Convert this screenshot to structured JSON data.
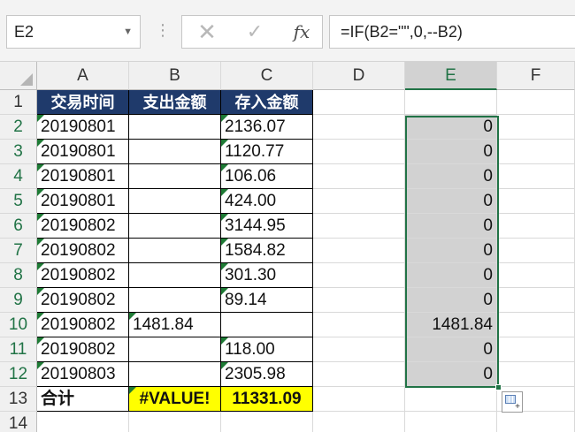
{
  "namebox": {
    "value": "E2"
  },
  "formula_bar": {
    "formula": "=IF(B2=\"\",0,--B2)",
    "cancel_icon": "close-icon",
    "enter_icon": "check-icon",
    "fx_label": "fx"
  },
  "columns": [
    "A",
    "B",
    "C",
    "D",
    "E",
    "F"
  ],
  "rows": [
    "1",
    "2",
    "3",
    "4",
    "5",
    "6",
    "7",
    "8",
    "9",
    "10",
    "11",
    "12",
    "13",
    "14"
  ],
  "table": {
    "headers": [
      "交易时间",
      "支出金额",
      "存入金额"
    ],
    "data": [
      [
        "20190801",
        "",
        "2136.07"
      ],
      [
        "20190801",
        "",
        "1120.77"
      ],
      [
        "20190801",
        "",
        "106.06"
      ],
      [
        "20190801",
        "",
        "424.00"
      ],
      [
        "20190802",
        "",
        "3144.95"
      ],
      [
        "20190802",
        "",
        "1584.82"
      ],
      [
        "20190802",
        "",
        "301.30"
      ],
      [
        "20190802",
        "",
        "89.14"
      ],
      [
        "20190802",
        "1481.84",
        ""
      ],
      [
        "20190802",
        "",
        "118.00"
      ],
      [
        "20190803",
        "",
        "2305.98"
      ]
    ],
    "total": [
      "合计",
      "#VALUE!",
      "11331.09"
    ]
  },
  "column_e": [
    "0",
    "0",
    "0",
    "0",
    "0",
    "0",
    "0",
    "0",
    "1481.84",
    "0",
    "0"
  ],
  "colors": {
    "header_fill": "#1f3a6b",
    "highlight": "#ffff00",
    "selection": "#217346"
  }
}
